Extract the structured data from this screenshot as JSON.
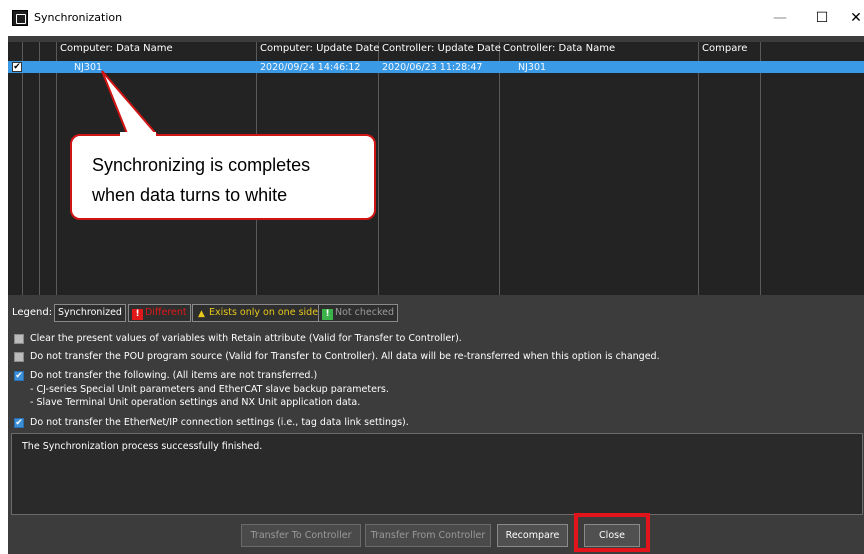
{
  "window": {
    "title": "Synchronization",
    "min_label": "—",
    "max_label": "☐",
    "close_label": "✕"
  },
  "grid": {
    "columns": [
      "Computer: Data Name",
      "Computer: Update Date",
      "Controller: Update Date",
      "Controller: Data Name",
      "Compare"
    ],
    "row": {
      "checked": true,
      "computer_name": "NJ301",
      "computer_date": "2020/09/24 14:46:12",
      "controller_date": "2020/06/23 11:28:47",
      "controller_name": "NJ301",
      "compare": ""
    }
  },
  "callout": {
    "line1": "Synchronizing is completes",
    "line2": "when data turns to white"
  },
  "legend": {
    "label": "Legend:",
    "synchronized": "Synchronized",
    "different": "Different",
    "one_side": "Exists only on one side",
    "not_checked": "Not checked",
    "colors": {
      "different": "#e01818",
      "one_side": "#e8c81a",
      "not_checked": "#3bb34a"
    }
  },
  "options": [
    {
      "checked": false,
      "text": "Clear the present values of variables with Retain attribute (Valid for Transfer to Controller)."
    },
    {
      "checked": false,
      "text": "Do not transfer the POU program source (Valid for Transfer to Controller). All data will be re-transferred when this option is changed."
    },
    {
      "checked": true,
      "text": "Do not transfer the following. (All items are not transferred.)",
      "sub": [
        "- CJ-series Special Unit parameters and EtherCAT slave backup parameters.",
        "- Slave Terminal Unit operation settings and NX Unit application data."
      ]
    },
    {
      "checked": true,
      "text": "Do not transfer the EtherNet/IP connection settings (i.e., tag data link settings)."
    }
  ],
  "message": "The Synchronization process successfully finished.",
  "buttons": {
    "transfer_to": "Transfer To Controller",
    "transfer_from": "Transfer From Controller",
    "recompare": "Recompare",
    "close": "Close"
  }
}
